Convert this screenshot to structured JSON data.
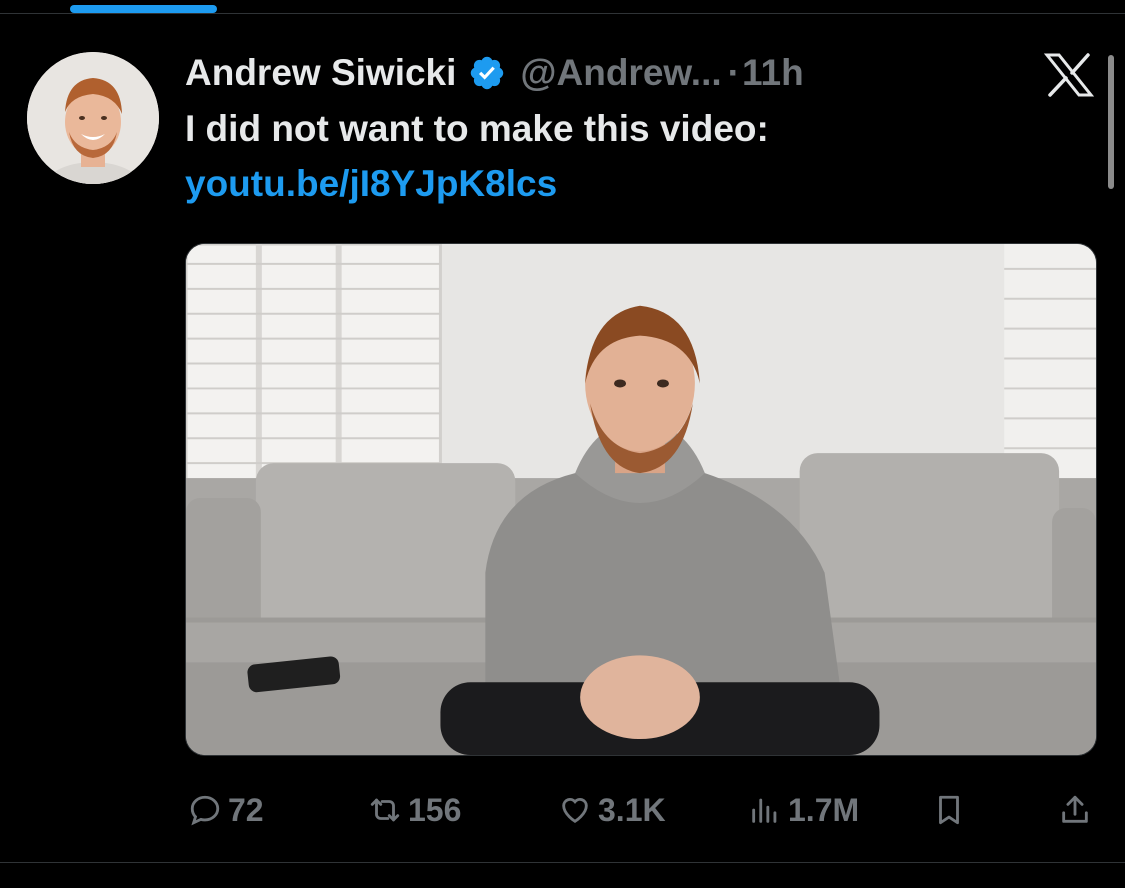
{
  "tweet": {
    "author_name": "Andrew Siwicki",
    "handle": "@Andrew...",
    "separator": "·",
    "time": "11h",
    "text": "I did not want to make this video:",
    "link": "youtu.be/jI8YJpK8lcs"
  },
  "actions": {
    "replies": "72",
    "reposts": "156",
    "likes": "3.1K",
    "views": "1.7M"
  },
  "icons": {
    "verified": "verified-badge-icon",
    "x_logo": "x-logo-icon",
    "reply": "reply-icon",
    "repost": "repost-icon",
    "like": "heart-icon",
    "views": "views-icon",
    "bookmark": "bookmark-icon",
    "share": "share-icon"
  },
  "colors": {
    "background": "#000000",
    "text": "#e7e9ea",
    "muted": "#71767b",
    "accent": "#1d9bf0"
  }
}
